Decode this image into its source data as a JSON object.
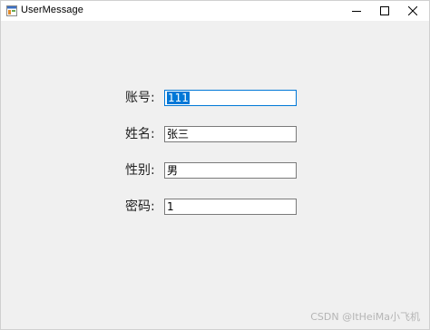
{
  "window": {
    "title": "UserMessage",
    "icon": "winforms-app-icon",
    "controls": {
      "minimize": "minimize-icon",
      "maximize": "maximize-icon",
      "close": "close-icon"
    }
  },
  "form": {
    "account": {
      "label": "账号:",
      "value": "111"
    },
    "name": {
      "label": "姓名:",
      "value": "张三"
    },
    "gender": {
      "label": "性别:",
      "value": "男"
    },
    "password": {
      "label": "密码:",
      "value": "1"
    }
  },
  "watermark": "CSDN @ItHeiMa小飞机",
  "colors": {
    "selection": "#0078d7",
    "background": "#f0f0f0"
  }
}
